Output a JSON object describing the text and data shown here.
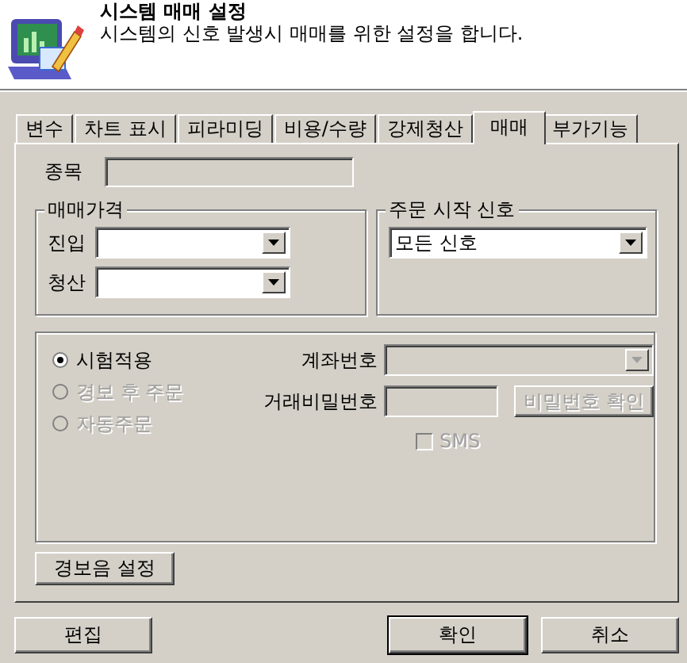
{
  "header": {
    "title": "시스템 매매 설정",
    "description": "시스템의 신호 발생시 매매를 위한 설정을 합니다."
  },
  "tabs": [
    {
      "label": "변수",
      "selected": false
    },
    {
      "label": "차트 표시",
      "selected": false
    },
    {
      "label": "피라미딩",
      "selected": false
    },
    {
      "label": "비용/수량",
      "selected": false
    },
    {
      "label": "강제청산",
      "selected": false
    },
    {
      "label": "매매",
      "selected": true
    },
    {
      "label": "부가기능",
      "selected": false
    }
  ],
  "symbol": {
    "label": "종목",
    "disabled": true
  },
  "price_group": {
    "title": "매매가격",
    "fields": [
      {
        "label": "진입"
      },
      {
        "label": "청산"
      }
    ]
  },
  "signal_group": {
    "title": "주문 시작 신호",
    "value": "모든 신호"
  },
  "order_modes": [
    {
      "label": "시험적용",
      "selected": true,
      "disabled": false
    },
    {
      "label": "경보 후 주문",
      "selected": false,
      "disabled": true
    },
    {
      "label": "자동주문",
      "selected": false,
      "disabled": true
    }
  ],
  "account": {
    "label": "계좌번호",
    "disabled": true
  },
  "password": {
    "label": "거래비밀번호",
    "disabled": true,
    "button": "비밀번호 확인"
  },
  "sms": {
    "label": "SMS",
    "checked": false,
    "disabled": true
  },
  "alarm_button": "경보음 설정",
  "buttons": [
    {
      "label": "편집",
      "default": false
    },
    {
      "label": "확인",
      "default": true
    },
    {
      "label": "취소",
      "default": false
    }
  ]
}
